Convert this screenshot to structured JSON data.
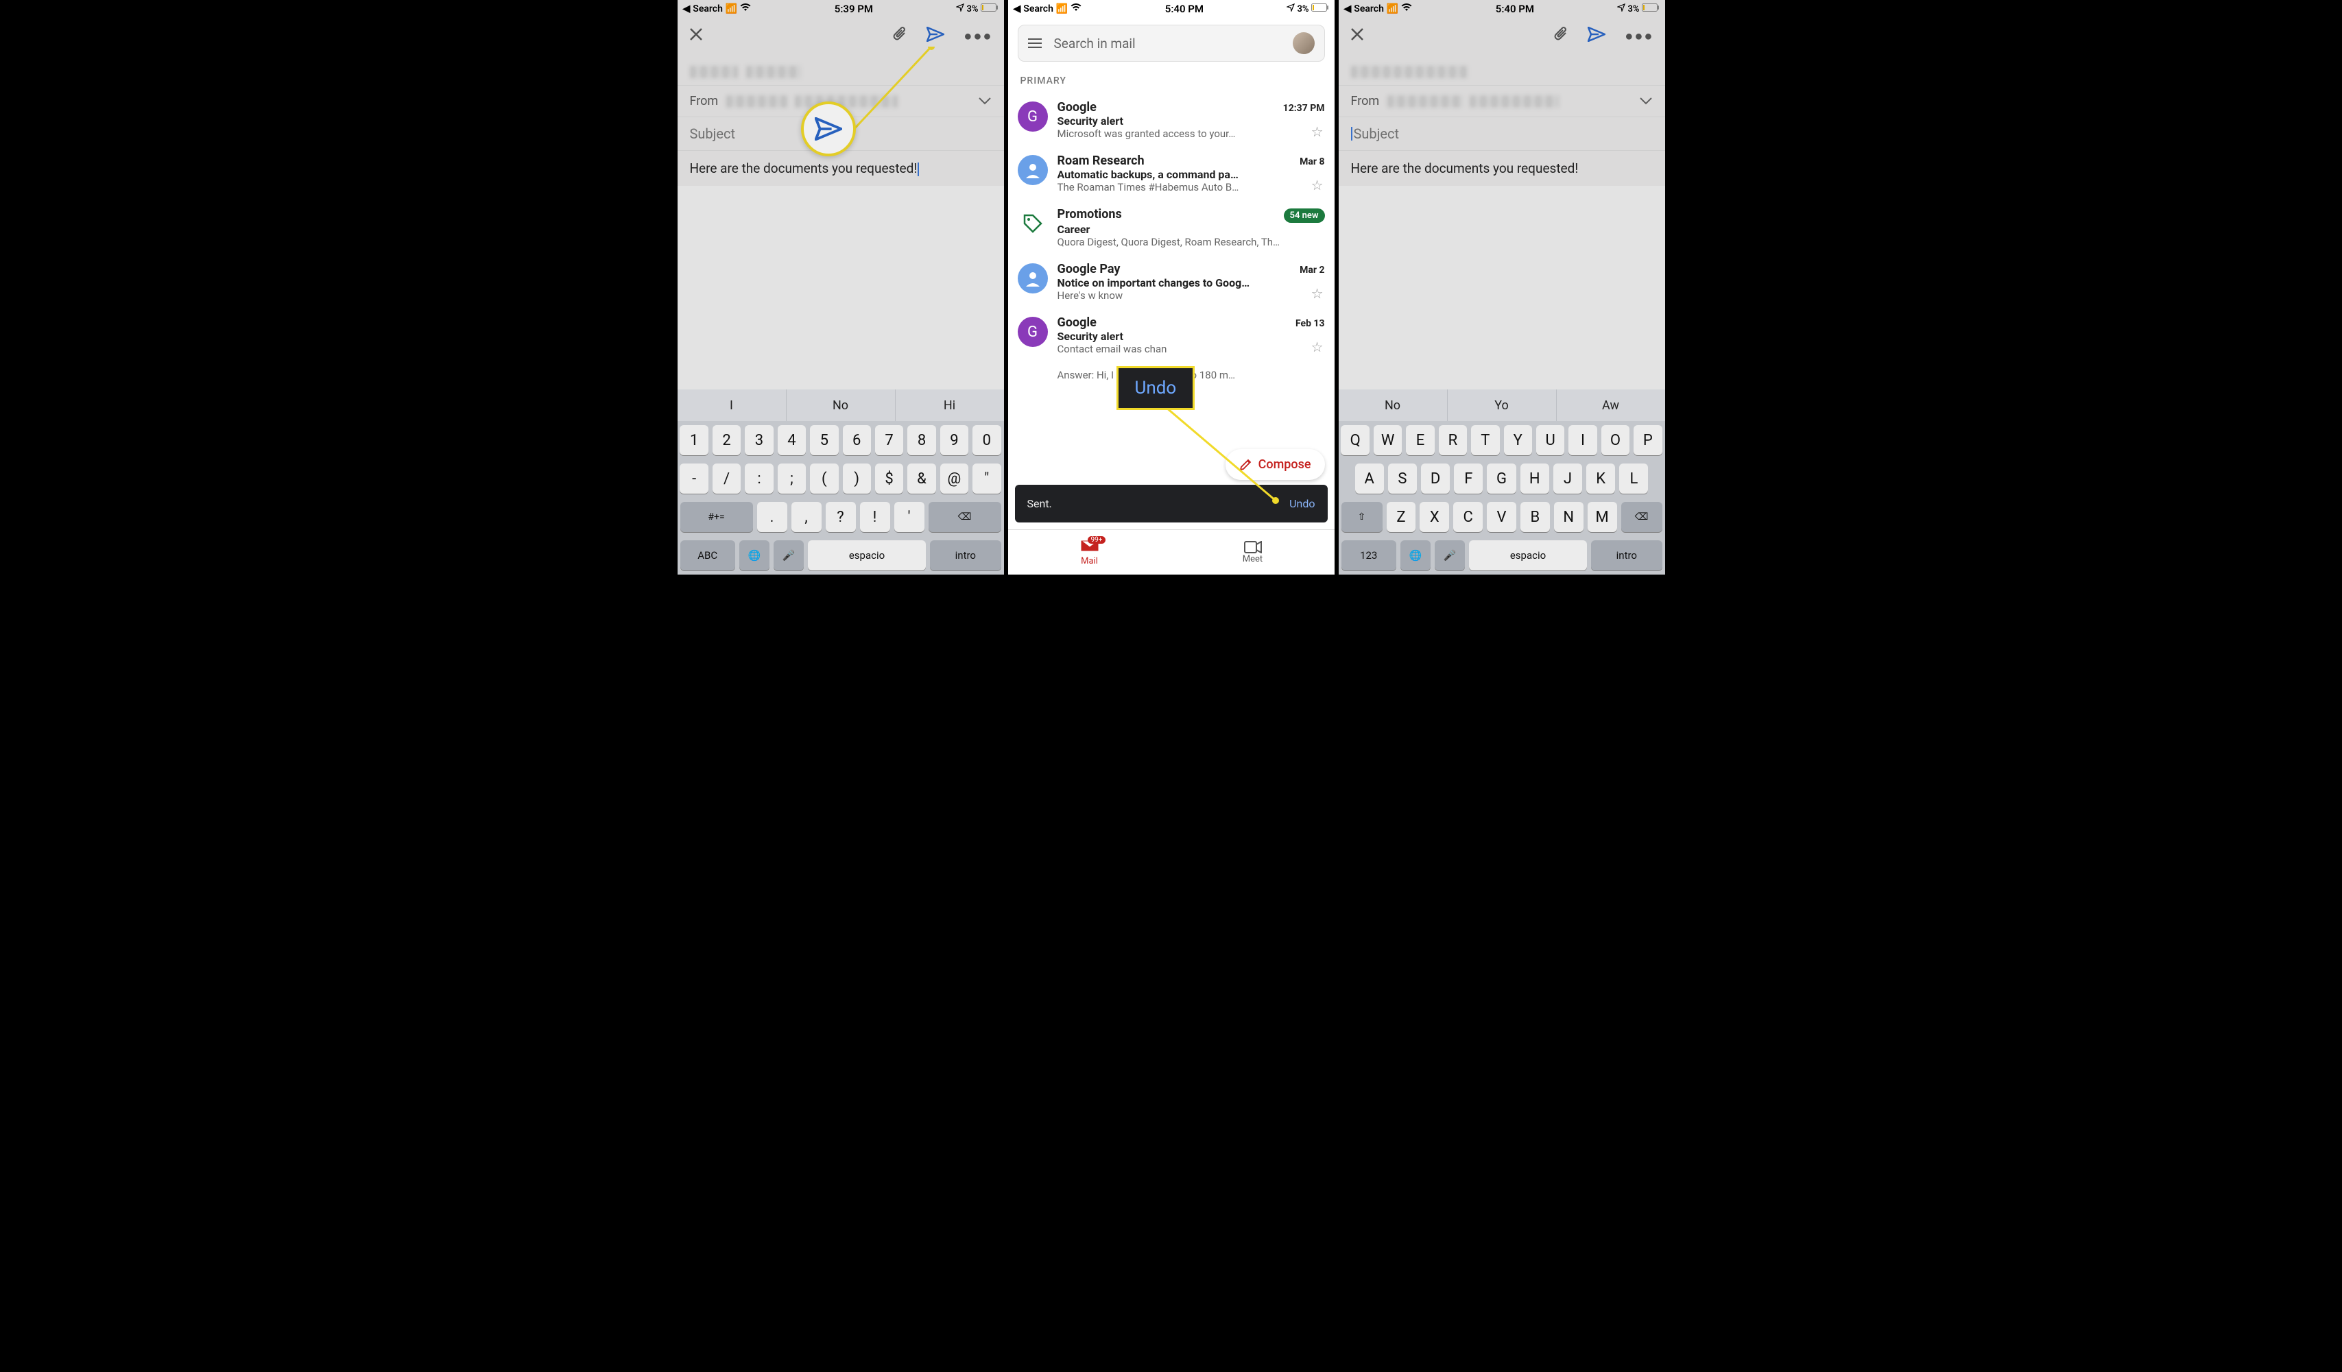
{
  "screen1": {
    "status": {
      "back": "Search",
      "time": "5:39 PM",
      "battery": "3%"
    },
    "compose": {
      "from_label": "From",
      "subject_placeholder": "Subject",
      "body": "Here are the documents you requested!"
    },
    "suggestions": [
      "I",
      "No",
      "Hi"
    ],
    "num_row": [
      "1",
      "2",
      "3",
      "4",
      "5",
      "6",
      "7",
      "8",
      "9",
      "0"
    ],
    "sym_row": [
      "-",
      "/",
      ":",
      ";",
      "(",
      ")",
      "$",
      "&",
      "@",
      "\""
    ],
    "sym_row2": [
      "#+=",
      ".",
      ",",
      "?",
      "!",
      "'",
      "⌫"
    ],
    "bottom_row": {
      "abc": "ABC",
      "globe": "🌐",
      "mic": "🎤",
      "space": "espacio",
      "enter": "intro"
    }
  },
  "screen2": {
    "status": {
      "back": "Search",
      "time": "5:40 PM",
      "battery": "3%"
    },
    "search_placeholder": "Search in mail",
    "primary_label": "PRIMARY",
    "emails": [
      {
        "sender": "Google",
        "subject": "Security alert",
        "snippet": "Microsoft was granted access to your…",
        "time": "12:37 PM",
        "avatar": "G",
        "color": "#8a3ab9"
      },
      {
        "sender": "Roam Research",
        "subject": "Automatic backups, a command pa…",
        "snippet": "The Roaman Times #Habemus Auto B…",
        "time": "Mar 8",
        "avatar": "person",
        "color": "#6aa0e8"
      },
      {
        "sender": "Promotions",
        "subject": "Career",
        "snippet": "Quora Digest, Quora Digest, Roam Research, Th…",
        "badge": "54 new",
        "promo": true
      },
      {
        "sender": "Google Pay",
        "subject": "Notice on important changes to Goog…",
        "snippet": "Here's w                               know",
        "time": "Mar 2",
        "avatar": "person",
        "color": "#6aa0e8"
      },
      {
        "sender": "Google",
        "subject": "Security alert",
        "snippet": "Contact email was chan",
        "time": "Feb 13",
        "avatar": "G",
        "color": "#8a3ab9"
      },
      {
        "sender": "",
        "subject": "",
        "snippet": "Answer: Hi, I was sentenced to 180 m…",
        "time": ""
      }
    ],
    "compose_label": "Compose",
    "snackbar_text": "Sent.",
    "snackbar_action": "Undo",
    "nav_mail": "Mail",
    "nav_mail_badge": "99+",
    "nav_meet": "Meet",
    "callout_undo": "Undo"
  },
  "screen3": {
    "status": {
      "back": "Search",
      "time": "5:40 PM",
      "battery": "3%"
    },
    "compose": {
      "from_label": "From",
      "subject_placeholder": "Subject",
      "body": "Here are the documents you requested!"
    },
    "suggestions": [
      "No",
      "Yo",
      "Aw"
    ],
    "qwerty_row1": [
      "Q",
      "W",
      "E",
      "R",
      "T",
      "Y",
      "U",
      "I",
      "O",
      "P"
    ],
    "qwerty_row2": [
      "A",
      "S",
      "D",
      "F",
      "G",
      "H",
      "J",
      "K",
      "L"
    ],
    "qwerty_row3": [
      "⇧",
      "Z",
      "X",
      "C",
      "V",
      "B",
      "N",
      "M",
      "⌫"
    ],
    "bottom_row": {
      "num": "123",
      "globe": "🌐",
      "mic": "🎤",
      "space": "espacio",
      "enter": "intro"
    }
  }
}
